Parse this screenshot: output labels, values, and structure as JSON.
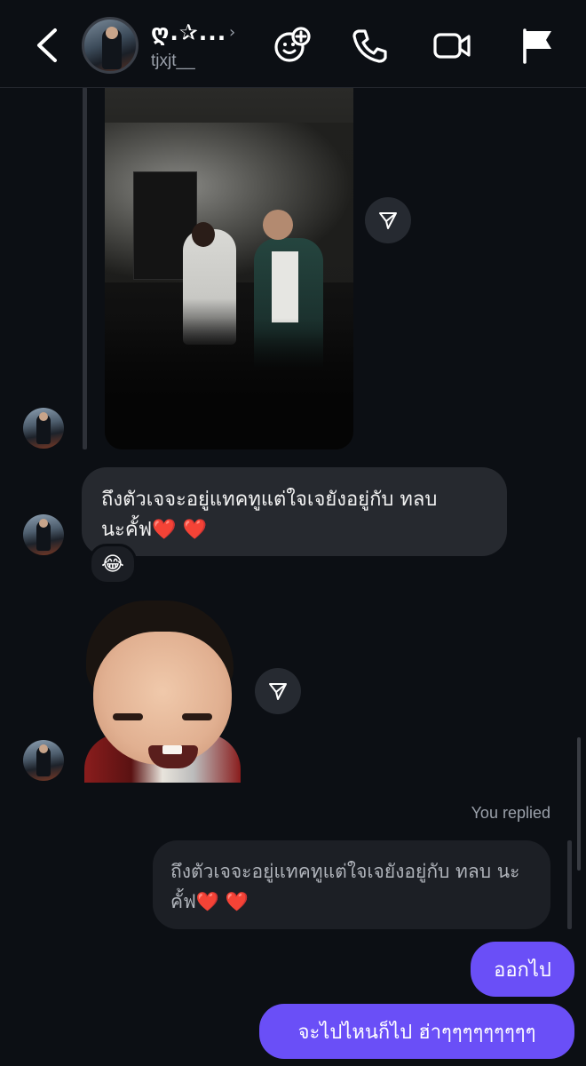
{
  "header": {
    "display_name": "ღ.✰...",
    "username": "tjxjt__",
    "icons": [
      "back-chevron-icon",
      "effects-face-icon",
      "phone-icon",
      "video-camera-icon",
      "flag-icon"
    ]
  },
  "messages": [
    {
      "type": "image",
      "from": "them",
      "description_icon": "concert-photo"
    },
    {
      "type": "text",
      "from": "them",
      "text_line1": "ถึงตัวเจจะอยู่แทคทูแต่ใจเจยังอยู่กับ ทลบ",
      "text_line2": "นะคั้ฟ",
      "hearts": "❤️ ❤️",
      "reaction": "😂"
    },
    {
      "type": "sticker",
      "from": "them"
    },
    {
      "type": "reply",
      "from": "me",
      "label": "You replied",
      "quoted_line1": "ถึงตัวเจจะอยู่แทคทูแต่ใจเจยังอยู่กับ ทลบ นะ",
      "quoted_line2": "คั้ฟ",
      "quoted_hearts": "❤️ ❤️"
    },
    {
      "type": "text",
      "from": "me",
      "text": "ออกไป"
    },
    {
      "type": "text",
      "from": "me",
      "text": "จะไปไหนก็ไป ฮ่าๆๆๆๆๆๆๆๆๆ"
    }
  ],
  "colors": {
    "background": "#0c0f14",
    "incoming_bubble": "#26292f",
    "outgoing_bubble": "#6a4ff7",
    "secondary_text": "#9aa0aa"
  }
}
